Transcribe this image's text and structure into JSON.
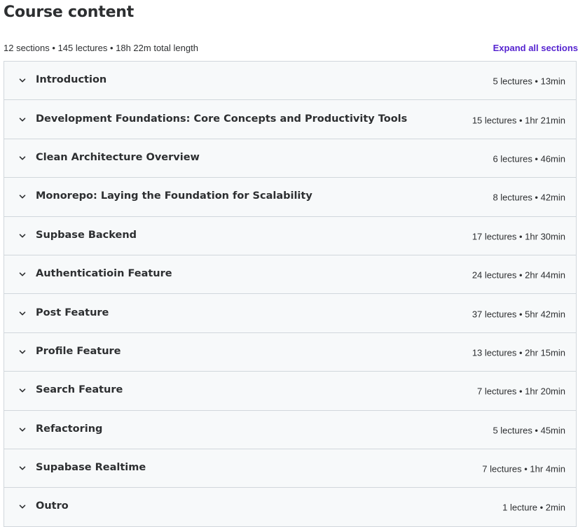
{
  "header": {
    "title": "Course content"
  },
  "summary": {
    "text": "12 sections • 145 lectures • 18h 22m total length",
    "expand_all_label": "Expand all sections"
  },
  "icons": {
    "section_toggle": "chevron-down-icon"
  },
  "colors": {
    "accent": "#5624d0",
    "row_background": "#f7f9fa",
    "border": "#d1d7dc",
    "text": "#2d2f31"
  },
  "sections": [
    {
      "title": "Introduction",
      "meta": "5 lectures • 13min"
    },
    {
      "title": "Development Foundations: Core Concepts and Productivity Tools",
      "meta": "15 lectures • 1hr 21min"
    },
    {
      "title": "Clean Architecture Overview",
      "meta": "6 lectures • 46min"
    },
    {
      "title": "Monorepo: Laying the Foundation for Scalability",
      "meta": "8 lectures • 42min"
    },
    {
      "title": "Supbase Backend",
      "meta": "17 lectures • 1hr 30min"
    },
    {
      "title": "Authenticatioin Feature",
      "meta": "24 lectures • 2hr 44min"
    },
    {
      "title": "Post Feature",
      "meta": "37 lectures • 5hr 42min"
    },
    {
      "title": "Profile Feature",
      "meta": "13 lectures • 2hr 15min"
    },
    {
      "title": "Search Feature",
      "meta": "7 lectures • 1hr 20min"
    },
    {
      "title": "Refactoring",
      "meta": "5 lectures • 45min"
    },
    {
      "title": "Supabase Realtime",
      "meta": "7 lectures • 1hr 4min"
    },
    {
      "title": "Outro",
      "meta": "1 lecture • 2min"
    }
  ]
}
